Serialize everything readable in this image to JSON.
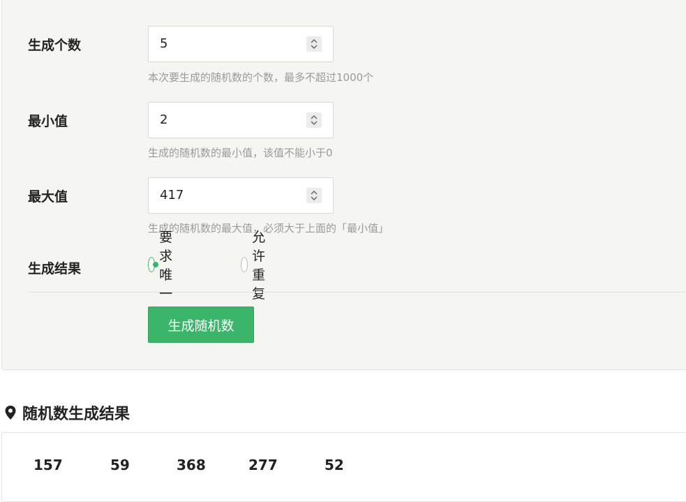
{
  "form": {
    "count": {
      "label": "生成个数",
      "value": "5",
      "hint": "本次要生成的随机数的个数，最多不超过1000个"
    },
    "min": {
      "label": "最小值",
      "value": "2",
      "hint": "生成的随机数的最小值，该值不能小于0"
    },
    "max": {
      "label": "最大值",
      "value": "417",
      "hint": "生成的随机数的最大值，必须大于上面的「最小值」"
    },
    "result_mode": {
      "label": "生成结果",
      "options": [
        {
          "label": "要求唯一",
          "checked": true
        },
        {
          "label": "允许重复",
          "checked": false
        }
      ]
    },
    "submit_label": "生成随机数"
  },
  "results": {
    "title": "随机数生成结果",
    "icon": "map-marker-icon",
    "numbers": [
      "157",
      "59",
      "368",
      "277",
      "52"
    ]
  },
  "colors": {
    "accent": "#3bb56a",
    "panel_bg": "#f5f5f2",
    "hint": "#9a9a9a"
  }
}
